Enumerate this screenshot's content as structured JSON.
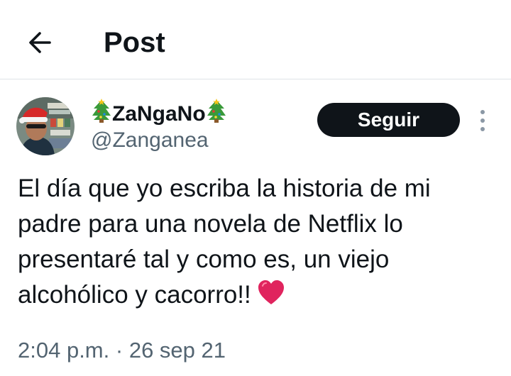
{
  "header": {
    "title": "Post",
    "back_icon": "arrow-left-icon"
  },
  "author": {
    "name_prefix_icon": "christmas-tree-icon",
    "display_name": "ZaNgaNo",
    "name_suffix_icon": "christmas-tree-icon",
    "handle": "@Zanganea",
    "avatar": "avatar"
  },
  "actions": {
    "follow_label": "Seguir",
    "more_icon": "more-vertical-icon"
  },
  "tweet": {
    "text": "El día que yo escriba la historia de mi padre para una novela de Netflix lo presentaré tal y como es, un viejo alcohólico y cacorro!!",
    "emoji_icon": "red-heart-icon",
    "time": "2:04 p.m.",
    "separator": "·",
    "date": "26 sep 21"
  },
  "colors": {
    "text_primary": "#0f1419",
    "text_secondary": "#536471",
    "button_bg": "#0f1419",
    "divider": "#dfe3e6",
    "heart": "#e0245e"
  }
}
